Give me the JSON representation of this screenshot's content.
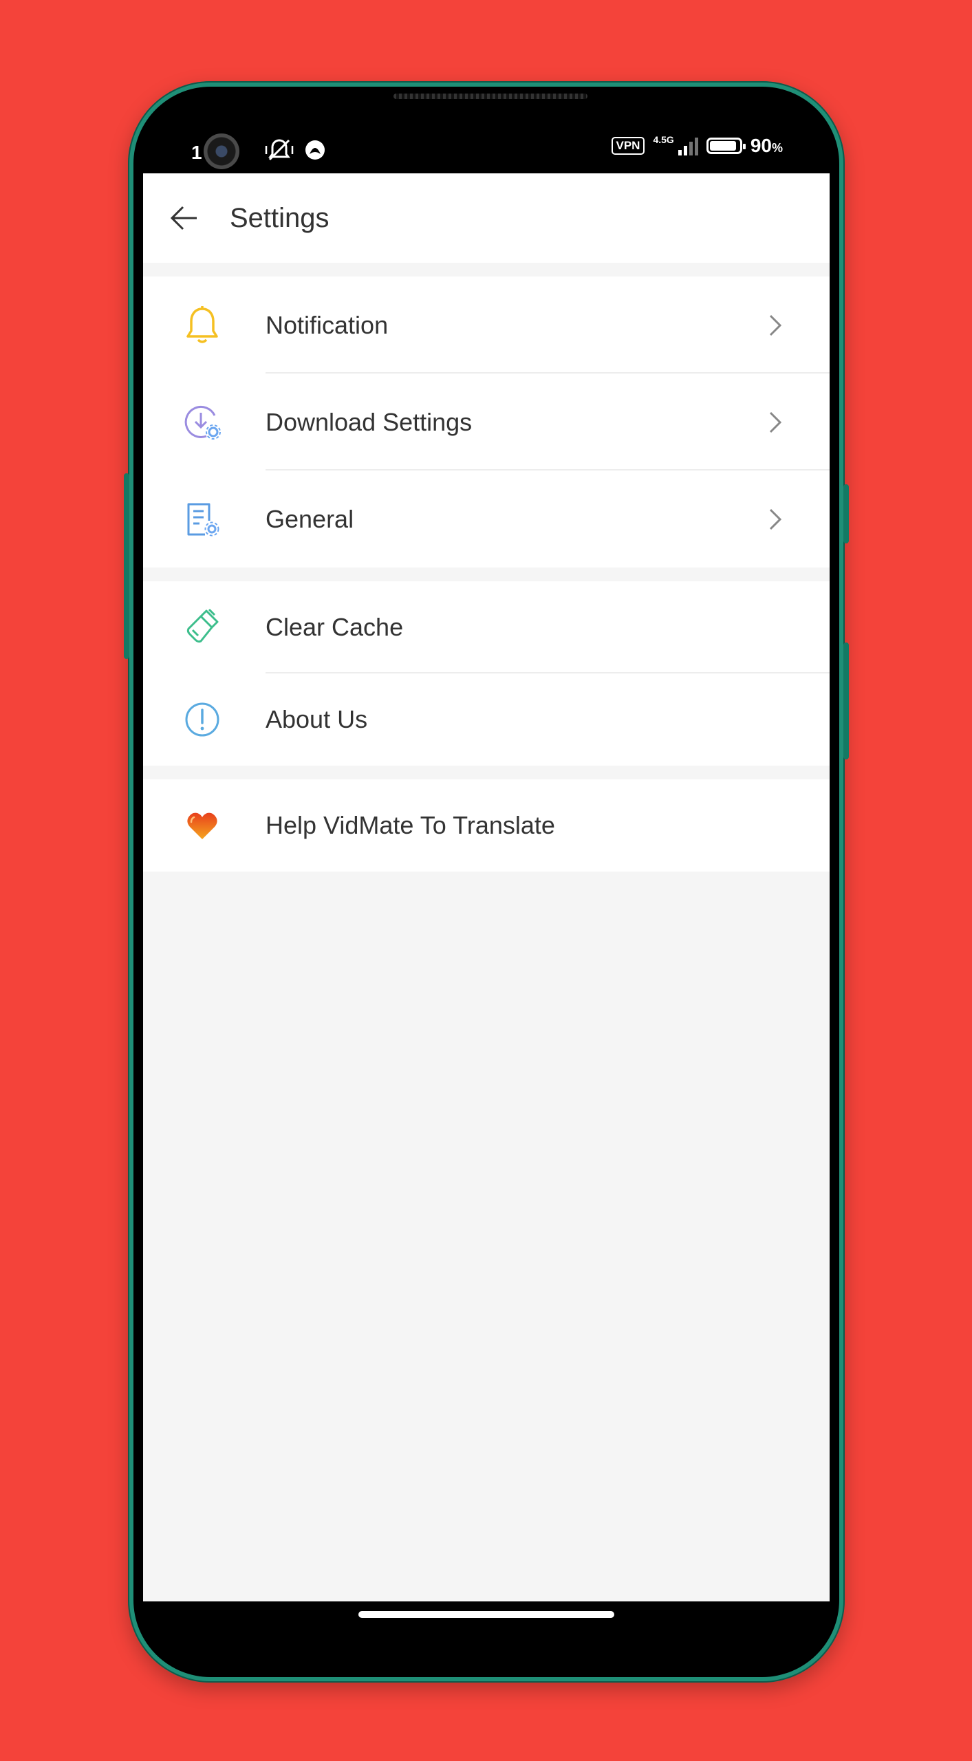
{
  "status_bar": {
    "time": "1",
    "vpn": "VPN",
    "network": "4.5G",
    "battery_level": 0.9,
    "battery_value": "90",
    "battery_unit": "%"
  },
  "header": {
    "title": "Settings"
  },
  "groups": [
    {
      "items": [
        {
          "label": "Notification",
          "icon": "bell-icon",
          "color": "#F5C022",
          "chevron": true
        },
        {
          "label": "Download Settings",
          "icon": "download-settings-icon",
          "color": "#9A8CE0",
          "chevron": true
        },
        {
          "label": "General",
          "icon": "document-gear-icon",
          "color": "#5A9BE2",
          "chevron": true
        }
      ]
    },
    {
      "items": [
        {
          "label": "Clear Cache",
          "icon": "brush-icon",
          "color": "#3DBE8C",
          "chevron": false
        },
        {
          "label": "About Us",
          "icon": "info-icon",
          "color": "#5AAAE0",
          "chevron": false
        }
      ]
    },
    {
      "items": [
        {
          "label": "Help VidMate To Translate",
          "icon": "heart-icon",
          "color": "#E8401C",
          "chevron": false
        }
      ]
    }
  ],
  "colors": {
    "background": "#F4433A",
    "phone_frame": "#1F8F77",
    "screen_bg": "#F5F5F5"
  }
}
